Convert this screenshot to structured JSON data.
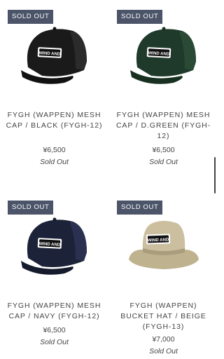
{
  "products": [
    {
      "badge": "SOLD OUT",
      "title": "FYGH (WAPPEN) MESH CAP / BLACK (FYGH-12)",
      "price": "¥6,500",
      "status": "Sold Out",
      "color": "#1a1a1a",
      "logo": "WIND AND",
      "icon": "trucker-cap"
    },
    {
      "badge": "SOLD OUT",
      "title": "FYGH (WAPPEN) MESH CAP / D.GREEN (FYGH-12)",
      "price": "¥6,500",
      "status": "Sold Out",
      "color": "#1f3a2a",
      "logo": "WIND AND",
      "icon": "trucker-cap"
    },
    {
      "badge": "SOLD OUT",
      "title": "FYGH (WAPPEN) MESH CAP / NAVY (FYGH-12)",
      "price": "¥6,500",
      "status": "Sold Out",
      "color": "#1c2238",
      "logo": "WIND AND",
      "icon": "trucker-cap"
    },
    {
      "badge": "SOLD OUT",
      "title": "FYGH (WAPPEN) BUCKET HAT / BEIGE (FYGH-13)",
      "price": "¥7,000",
      "status": "Sold Out",
      "color": "#cbbf9f",
      "logo": "WIND AND",
      "icon": "bucket-hat"
    }
  ]
}
